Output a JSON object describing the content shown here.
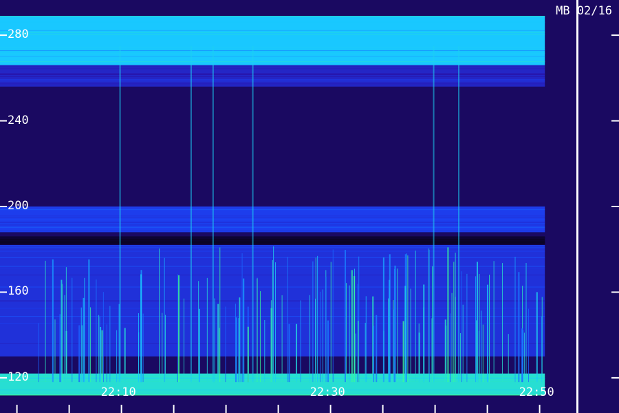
{
  "chart_data": {
    "type": "heatmap",
    "title": "MB 02/16",
    "ylabel": "",
    "xlabel": "",
    "y_ticks": [
      "280",
      "240",
      "200",
      "160",
      "120"
    ],
    "y_tick_values": [
      280,
      240,
      200,
      160,
      120
    ],
    "ylim": [
      110,
      290
    ],
    "x_ticks": [
      "22:10",
      "22:30",
      "22:50"
    ],
    "x_tick_minutes": [
      10,
      30,
      50
    ],
    "xlim_minutes": [
      2,
      52
    ],
    "bands": [
      {
        "y_from": 266,
        "y_to": 289,
        "intensity": 0.75
      },
      {
        "y_from": 256,
        "y_to": 266,
        "intensity": 0.35
      },
      {
        "y_from": 188,
        "y_to": 200,
        "intensity": 0.45
      },
      {
        "y_from": 182,
        "y_to": 186,
        "intensity": 0.0
      },
      {
        "y_from": 130,
        "y_to": 182,
        "intensity": 0.4
      },
      {
        "y_from": 112,
        "y_to": 122,
        "intensity": 0.85
      }
    ],
    "data_end_minute": 50.5,
    "colormap": [
      "#0b0426",
      "#2a0fa0",
      "#1a48ff",
      "#19c8ff",
      "#3cff90"
    ]
  }
}
